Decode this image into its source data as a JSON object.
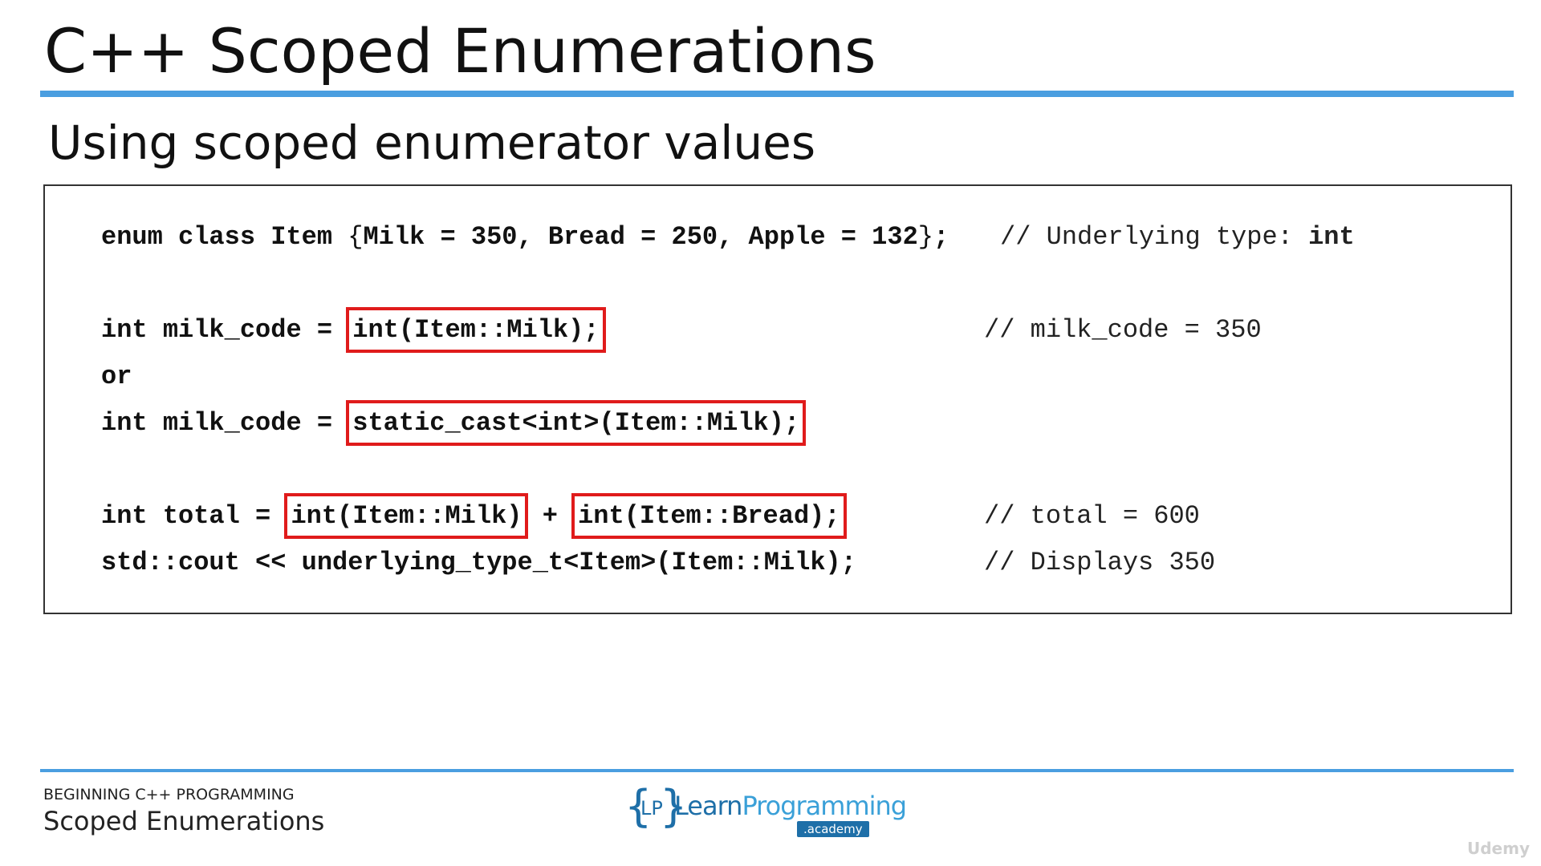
{
  "slide": {
    "title": "C++ Scoped Enumerations",
    "subtitle": "Using scoped enumerator values"
  },
  "code": {
    "line1": {
      "pre": "enum class Item ",
      "brace_open": "{",
      "body": "Milk = 350, Bread = 250, Apple = 132",
      "brace_close": "}",
      "end": ";",
      "comment_pre": "// Underlying type: ",
      "comment_kw": "int"
    },
    "line2": {
      "pre": "int milk_code = ",
      "highlight": "int(Item::Milk);",
      "comment": "// milk_code = 350"
    },
    "line3": {
      "text": "or"
    },
    "line4": {
      "pre": "int milk_code = ",
      "highlight": "static_cast<int>(Item::Milk);"
    },
    "line5": {
      "pre": "int total = ",
      "highlight1": "int(Item::Milk)",
      "mid": " + ",
      "highlight2": "int(Item::Bread);",
      "comment": "// total = 600"
    },
    "line6": {
      "text": "std::cout << underlying_type_t<Item>(Item::Milk);",
      "comment": "// Displays 350"
    }
  },
  "footer": {
    "course": "BEGINNING C++ PROGRAMMING",
    "topic": "Scoped Enumerations"
  },
  "logo": {
    "brace_left": "{",
    "initials": "LP",
    "brace_right": "}",
    "learn": "Learn",
    "programming": "Programming",
    "academy": ".academy"
  },
  "watermark": "Udemy",
  "colors": {
    "accent": "#4a9ee0",
    "highlight_border": "#e01b1b",
    "logo_blue": "#1e6fa8"
  }
}
